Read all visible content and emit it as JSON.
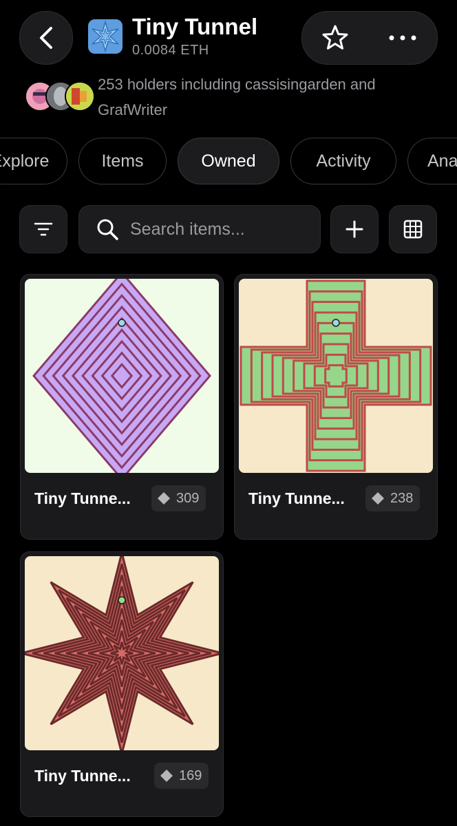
{
  "header": {
    "title": "Tiny Tunnel",
    "price": "0.0084 ETH",
    "holders_text": "253 holders including cassisingarden and GrafWriter"
  },
  "tabs": [
    {
      "label": "Explore"
    },
    {
      "label": "Items"
    },
    {
      "label": "Owned"
    },
    {
      "label": "Activity"
    },
    {
      "label": "Analytics"
    }
  ],
  "active_tab": "Owned",
  "search": {
    "placeholder": "Search items..."
  },
  "items": [
    {
      "name": "Tiny Tunne...",
      "count": "309",
      "shape": "diamond",
      "bg": "#f0fbe8",
      "fill": "#c8a8f4",
      "stroke": "#8a3b6a"
    },
    {
      "name": "Tiny Tunne...",
      "count": "238",
      "shape": "cross",
      "bg": "#f6e8c8",
      "fill": "#96d68a",
      "stroke": "#c04a4a"
    },
    {
      "name": "Tiny Tunne...",
      "count": "169",
      "shape": "star",
      "bg": "#f6e8c8",
      "fill": "#d66a66",
      "stroke": "#6a2a2a"
    }
  ],
  "colors": {
    "background": "#000000",
    "surface": "#1c1c1e",
    "muted_text": "#9a9aa0",
    "collection_thumb": "#6aa8e8"
  }
}
